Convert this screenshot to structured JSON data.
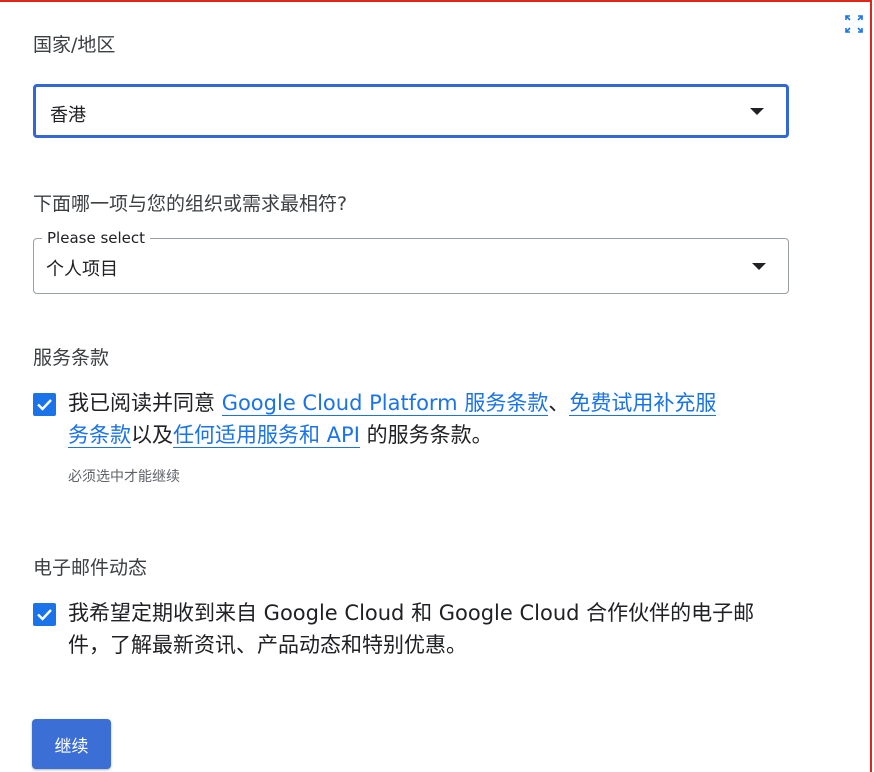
{
  "colors": {
    "accent": "#1a73e8",
    "focus_border": "#3367d6",
    "frame_border": "#e0251b",
    "button": "#3b6fd6"
  },
  "country": {
    "label": "国家/地区",
    "selected": "香港"
  },
  "organization": {
    "question": "下面哪一项与您的组织或需求最相符?",
    "float_label": "Please select",
    "selected": "个人项目"
  },
  "terms": {
    "heading": "服务条款",
    "checked": true,
    "text_1": "我已阅读并同意 ",
    "link_gcp": "Google Cloud Platform 服务条款",
    "text_2": "、",
    "link_trial_a": "免费试用补充服",
    "link_trial_b": "务条款",
    "text_3": "以及",
    "link_services": "任何适用服务和 API",
    "text_4": " 的服务条款。",
    "required_note": "必须选中才能继续"
  },
  "email": {
    "heading": "电子邮件动态",
    "checked": true,
    "text": "我希望定期收到来自 Google Cloud 和 Google Cloud 合作伙伴的电子邮件，了解最新资讯、产品动态和特别优惠。"
  },
  "actions": {
    "continue_label": "继续"
  },
  "icons": {
    "expand": "expand-icon",
    "dropdown": "dropdown-arrow-icon",
    "check": "check-icon"
  }
}
